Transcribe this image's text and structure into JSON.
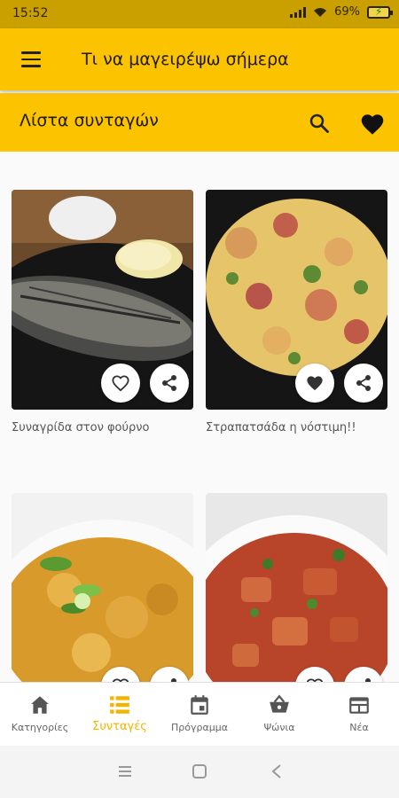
{
  "status": {
    "time": "15:52",
    "battery": "69%"
  },
  "app_bar": {
    "title": "Τι να μαγειρέψω σήμερα",
    "menu_icon": "menu-icon"
  },
  "sub_bar": {
    "title": "Λίστα συνταγών",
    "search_icon": "search-icon",
    "favorites_icon": "heart-icon"
  },
  "recipes": [
    {
      "title": "Συναγρίδα στον φούρνο",
      "favorited": false
    },
    {
      "title": "Στραπατσάδα η νόστιμη!!",
      "favorited": true
    },
    {
      "title": "",
      "favorited": false
    },
    {
      "title": "",
      "favorited": false
    }
  ],
  "bottom_nav": [
    {
      "label": "Κατηγορίες",
      "icon": "home-icon",
      "active": false
    },
    {
      "label": "Συνταγές",
      "icon": "list-icon",
      "active": true
    },
    {
      "label": "Πρόγραμμα",
      "icon": "calendar-icon",
      "active": false
    },
    {
      "label": "Ψώνια",
      "icon": "basket-icon",
      "active": false
    },
    {
      "label": "Νέα",
      "icon": "news-icon",
      "active": false
    }
  ],
  "colors": {
    "primary": "#fcc300",
    "status_bar": "#c9a000",
    "active_nav": "#f4b400"
  }
}
